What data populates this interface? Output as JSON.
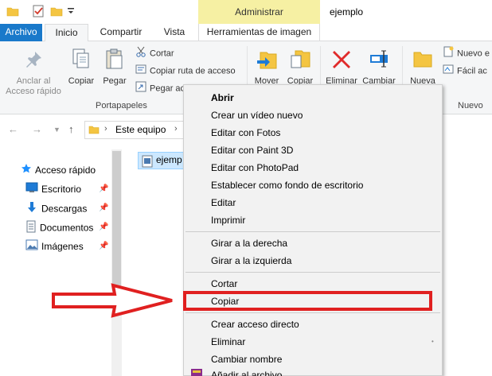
{
  "window": {
    "title": "ejemplo",
    "context_tab_group": "Administrar"
  },
  "tabs": [
    {
      "label": "Archivo"
    },
    {
      "label": "Inicio"
    },
    {
      "label": "Compartir"
    },
    {
      "label": "Vista"
    },
    {
      "label": "Herramientas de imagen"
    }
  ],
  "ribbon": {
    "portapapeles": {
      "group_label": "Portapapeles",
      "anclar": "Anclar al\nAcceso rápido",
      "anclar_line1": "Anclar al",
      "anclar_line2": "Acceso rápido",
      "copiar": "Copiar",
      "pegar": "Pegar",
      "cortar": "Cortar",
      "copiar_ruta": "Copiar ruta de acceso",
      "pegar_acceso": "Pegar ac"
    },
    "organizar": {
      "mover": "Mover",
      "copiar": "Copiar",
      "eliminar": "Eliminar",
      "cambiar": "Cambiar"
    },
    "nuevo": {
      "group_label": "Nuevo",
      "nueva": "Nueva",
      "nuevo_elemento": "Nuevo e",
      "facil_acceso": "Fácil ac"
    }
  },
  "address": {
    "path": "Este equipo"
  },
  "nav_pane": {
    "items": [
      {
        "label": "Acceso rápido",
        "icon": "star-icon",
        "color": "#1e90ff"
      },
      {
        "label": "Escritorio",
        "icon": "desktop-icon",
        "pinned": true,
        "color": "#1e7bd6"
      },
      {
        "label": "Descargas",
        "icon": "download-icon",
        "pinned": true,
        "color": "#1e7bd6"
      },
      {
        "label": "Documentos",
        "icon": "document-icon",
        "pinned": true,
        "color": "#6b7d8f"
      },
      {
        "label": "Imágenes",
        "icon": "pictures-icon",
        "pinned": true,
        "color": "#4a7ab0"
      }
    ]
  },
  "file_area": {
    "selected_file": "ejemp"
  },
  "context_menu": {
    "items": [
      {
        "label": "Abrir",
        "bold": true
      },
      {
        "label": "Crear un vídeo nuevo"
      },
      {
        "label": "Editar con Fotos"
      },
      {
        "label": "Editar con Paint 3D"
      },
      {
        "label": "Editar con PhotoPad"
      },
      {
        "label": "Establecer como fondo de escritorio"
      },
      {
        "label": "Editar"
      },
      {
        "label": "Imprimir"
      },
      {
        "label": "Girar a la derecha"
      },
      {
        "label": "Girar a la izquierda"
      },
      {
        "label": "Cortar"
      },
      {
        "label": "Copiar"
      },
      {
        "label": "Crear acceso directo"
      },
      {
        "label": "Eliminar"
      },
      {
        "label": "Cambiar nombre"
      },
      {
        "label": "Añadir al archivo..."
      }
    ]
  },
  "annotation": {
    "highlight_color": "#e02020"
  }
}
